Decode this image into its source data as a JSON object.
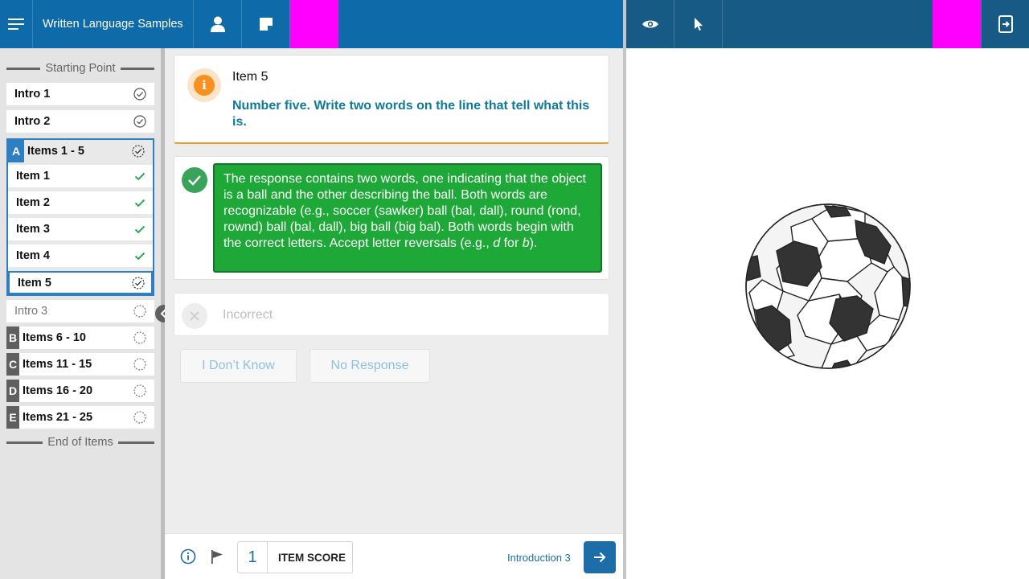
{
  "header": {
    "title": "Written Language Samples",
    "accent_color": "#0e6aa8",
    "right_bar_color": "#175a86",
    "placeholder_color": "#ff00ff"
  },
  "sidebar": {
    "start_label": "Starting Point",
    "end_label": "End of Items",
    "intros": [
      {
        "label": "Intro 1",
        "status": "complete"
      },
      {
        "label": "Intro 2",
        "status": "complete"
      }
    ],
    "group_a": {
      "letter": "A",
      "label": "Items 1 - 5",
      "status": "in-progress",
      "items": [
        {
          "label": "Item 1",
          "status": "scored"
        },
        {
          "label": "Item 2",
          "status": "scored"
        },
        {
          "label": "Item 3",
          "status": "scored"
        },
        {
          "label": "Item 4",
          "status": "scored"
        },
        {
          "label": "Item 5",
          "status": "in-progress"
        }
      ]
    },
    "intro3": {
      "label": "Intro 3",
      "status": "not-started"
    },
    "groups": [
      {
        "letter": "B",
        "label": "Items 6 - 10",
        "status": "not-started"
      },
      {
        "letter": "C",
        "label": "Items 11 - 15",
        "status": "not-started"
      },
      {
        "letter": "D",
        "label": "Items 16 - 20",
        "status": "not-started"
      },
      {
        "letter": "E",
        "label": "Items 21 - 25",
        "status": "not-started"
      }
    ]
  },
  "item": {
    "title": "Item 5",
    "prompt": "Number five. Write two words on the line that tell what this is.",
    "correct_text_main": "The response contains two words, one indicating that the object is a ball and the other describing the ball. Both words are recognizable (e.g., soccer (sawker) ball (bal, dall), round (rond, rownd) ball (bal, dall), big ball (big bal). Both words begin with the correct letters. Accept letter reversals (e.g., ",
    "correct_text_d": "d",
    "correct_text_for": " for ",
    "correct_text_b": "b",
    "correct_text_end": ").",
    "incorrect_label": "Incorrect",
    "dont_know_label": "I Don’t Know",
    "no_response_label": "No Response",
    "correct_color": "#1ea838"
  },
  "footer": {
    "score_value": "1",
    "score_label": "ITEM SCORE",
    "next_label": "Introduction 3"
  },
  "stimulus": {
    "image": "soccer-ball"
  }
}
